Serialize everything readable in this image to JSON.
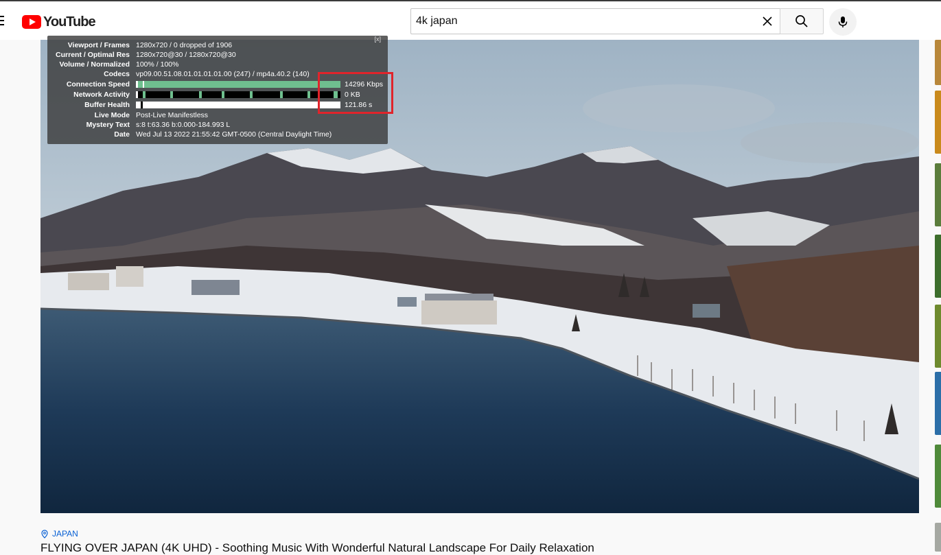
{
  "masthead": {
    "logo_text": "YouTube",
    "search": {
      "value": "4k japan",
      "placeholder": "Search"
    }
  },
  "stats": {
    "close_label": "[x]",
    "rows": [
      {
        "label": "Viewport / Frames",
        "value": "1280x720 / 0 dropped of 1906"
      },
      {
        "label": "Current / Optimal Res",
        "value": "1280x720@30 / 1280x720@30"
      },
      {
        "label": "Volume / Normalized",
        "value": "100% / 100%"
      },
      {
        "label": "Codecs",
        "value": "vp09.00.51.08.01.01.01.01.00 (247) / mp4a.40.2 (140)"
      },
      {
        "label": "Connection Speed",
        "value": "14296 Kbps"
      },
      {
        "label": "Network Activity",
        "value": "0 KB"
      },
      {
        "label": "Buffer Health",
        "value": "121.86 s"
      },
      {
        "label": "Live Mode",
        "value": "Post-Live Manifestless"
      },
      {
        "label": "Mystery Text",
        "value": "s:8 t:63.36 b:0.000-184.993 L"
      },
      {
        "label": "Date",
        "value": "Wed Jul 13 2022 21:55:42 GMT-0500 (Central Daylight Time)"
      }
    ]
  },
  "video": {
    "location_tag": "JAPAN",
    "title": "FLYING OVER JAPAN (4K UHD) - Soothing Music With Wonderful Natural Landscape For Daily Relaxation"
  },
  "colors": {
    "brand": "#ff0000",
    "link": "#065fd4",
    "graph_green": "#6fbf8f",
    "highlight": "#e0242b"
  },
  "icons": [
    "menu-icon",
    "youtube-logo-icon",
    "clear-icon",
    "search-icon",
    "mic-icon",
    "location-pin-icon"
  ]
}
